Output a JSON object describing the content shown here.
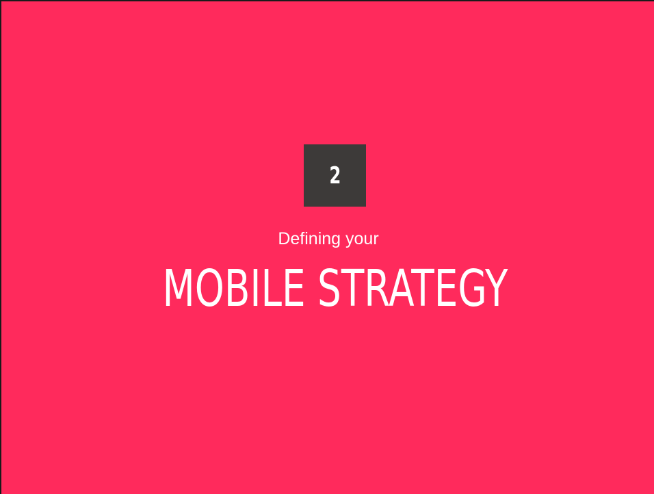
{
  "slide": {
    "section_number": "2",
    "subtitle": "Defining your",
    "title": "MOBILE STRATEGY"
  },
  "colors": {
    "background": "#ff2a5c",
    "badge": "#3d3a39",
    "text": "#ffffff"
  }
}
